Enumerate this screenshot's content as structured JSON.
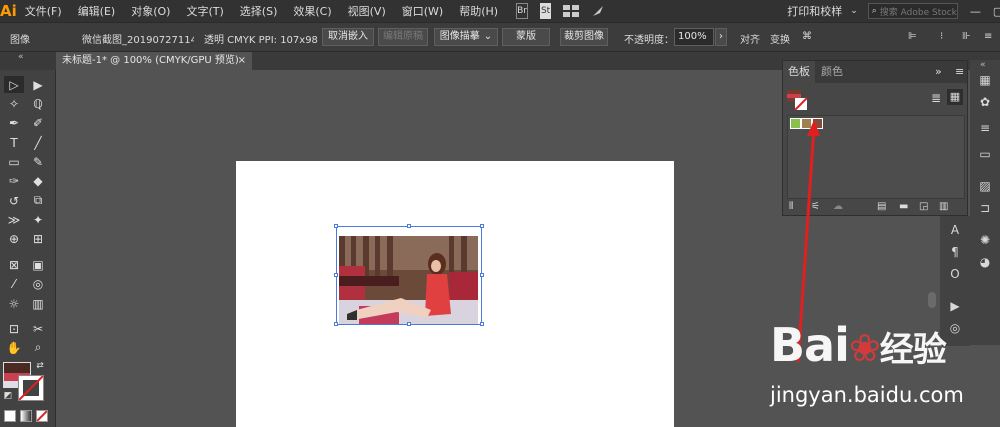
{
  "app": {
    "logo": "Ai"
  },
  "menubar": {
    "items": [
      "文件(F)",
      "编辑(E)",
      "对象(O)",
      "文字(T)",
      "选择(S)",
      "效果(C)",
      "视图(V)",
      "窗口(W)",
      "帮助(H)"
    ],
    "br_icon": "Br",
    "st_icon": "St",
    "workspace": "打印和校样",
    "search_placeholder": "搜索 Adobe Stock"
  },
  "controlbar": {
    "selection_type": "图像",
    "file_name": "微信截图_20190727114...",
    "file_info": "透明 CMYK  PPI: 107x98",
    "unembed": "取消嵌入",
    "edit_original": "编辑原稿",
    "image_trace": "图像描摹",
    "mask": "蒙版",
    "crop_image": "裁剪图像",
    "opacity_label": "不透明度：",
    "opacity_value": "100%",
    "align": "对齐",
    "transform": "变换"
  },
  "document": {
    "tab_title": "未标题-1* @ 100% (CMYK/GPU 预览)",
    "close": "×"
  },
  "swatches_panel": {
    "tabs": [
      "色板",
      "颜色"
    ],
    "collapse": "»",
    "menu": "≡"
  },
  "watermark": {
    "logo": "Bai",
    "logo_suffix": "经验",
    "url": "jingyan.baidu.com"
  },
  "colors": {
    "accent": "#ff9a00",
    "selection": "#4a7bd6",
    "arrow": "#e02020"
  }
}
